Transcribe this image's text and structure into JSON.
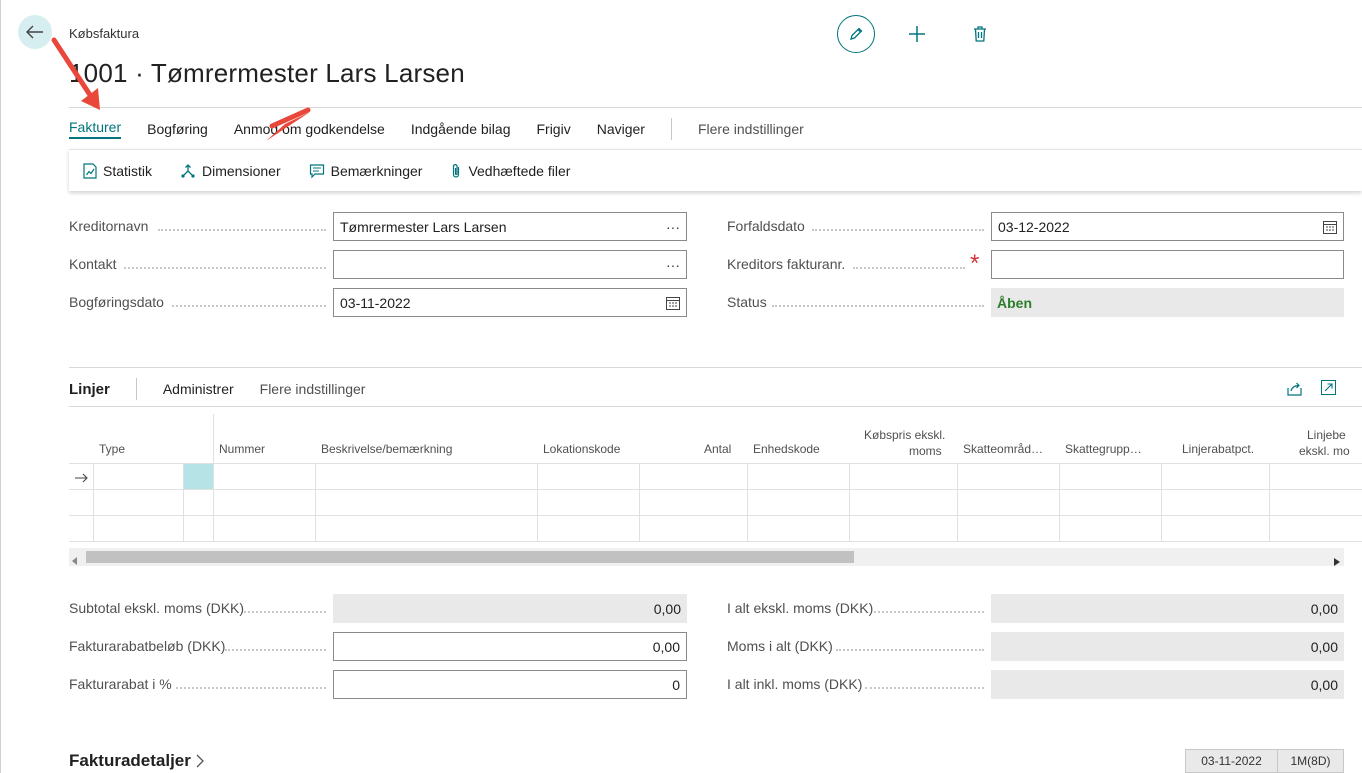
{
  "breadcrumb": "Købsfaktura",
  "page_title": "1001 · Tømrermester Lars Larsen",
  "menu": {
    "items": [
      "Fakturer",
      "Bogføring",
      "Anmod om godkendelse",
      "Indgående bilag",
      "Frigiv",
      "Naviger"
    ],
    "more": "Flere indstillinger"
  },
  "actions": {
    "statistik": "Statistik",
    "dimensioner": "Dimensioner",
    "bemaerkninger": "Bemærkninger",
    "vedhaeftede": "Vedhæftede filer"
  },
  "general": {
    "kreditornavn_label": "Kreditornavn",
    "kreditornavn_value": "Tømrermester Lars Larsen",
    "kontakt_label": "Kontakt",
    "kontakt_value": "",
    "bogforingsdato_label": "Bogføringsdato",
    "bogforingsdato_value": "03-11-2022",
    "forfaldsdato_label": "Forfaldsdato",
    "forfaldsdato_value": "03-12-2022",
    "kreditors_fakturanr_label": "Kreditors fakturanr.",
    "kreditors_fakturanr_value": "",
    "status_label": "Status",
    "status_value": "Åben",
    "ellipsis": "···"
  },
  "lines": {
    "title": "Linjer",
    "manage": "Administrer",
    "more": "Flere indstillinger",
    "columns": {
      "type": "Type",
      "nummer": "Nummer",
      "beskrivelse": "Beskrivelse/bemærkning",
      "lokation": "Lokationskode",
      "antal": "Antal",
      "enhed": "Enhedskode",
      "kobspris_1": "Købspris ekskl.",
      "kobspris_2": "moms",
      "skatteomr": "Skatteområd…",
      "skattegrp": "Skattegrupp…",
      "linjerabat": "Linjerabatpct.",
      "linjebelob_1": "Linjebe",
      "linjebelob_2": "ekskl. mo"
    }
  },
  "totals": {
    "subtotal_label": "Subtotal ekskl. moms (DKK)",
    "subtotal_value": "0,00",
    "rabatbelob_label": "Fakturarabatbeløb (DKK)",
    "rabatbelob_value": "0,00",
    "rabatpct_label": "Fakturarabat i %",
    "rabatpct_value": "0",
    "ialt_ekskl_label": "I alt ekskl. moms (DKK)",
    "ialt_ekskl_value": "0,00",
    "moms_label": "Moms i alt (DKK)",
    "moms_value": "0,00",
    "ialt_inkl_label": "I alt inkl. moms (DKK)",
    "ialt_inkl_value": "0,00"
  },
  "details": {
    "title": "Fakturadetaljer",
    "date_badge": "03-11-2022",
    "term_badge": "1M(8D)"
  },
  "colors": {
    "accent": "#00757d",
    "status_green": "#2c7d2c",
    "required_red": "#d13438",
    "annotation_red": "#e8473a"
  }
}
